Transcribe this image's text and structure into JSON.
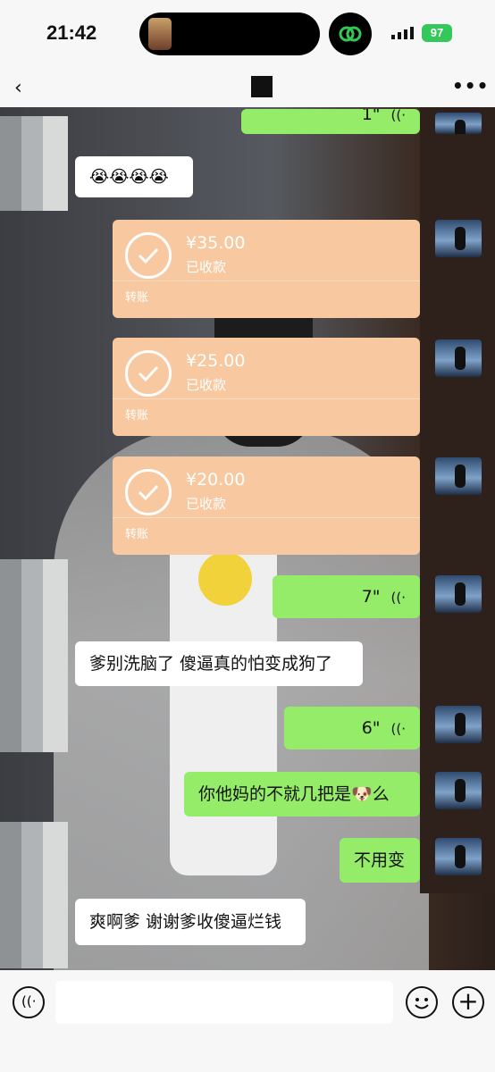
{
  "status_bar": {
    "time": "21:42",
    "battery": "97"
  },
  "header": {
    "back_label": "‹",
    "more_label": "•••"
  },
  "messages": [
    {
      "side": "right",
      "type": "voice",
      "duration": "1\"",
      "wave": "((·"
    },
    {
      "side": "left",
      "type": "text",
      "text": "😭😭😭😭"
    },
    {
      "side": "right",
      "type": "transfer",
      "amount": "¥35.00",
      "status": "已收款",
      "label": "转账"
    },
    {
      "side": "right",
      "type": "transfer",
      "amount": "¥25.00",
      "status": "已收款",
      "label": "转账"
    },
    {
      "side": "right",
      "type": "transfer",
      "amount": "¥20.00",
      "status": "已收款",
      "label": "转账"
    },
    {
      "side": "right",
      "type": "voice",
      "duration": "7\"",
      "wave": "((·"
    },
    {
      "side": "left",
      "type": "text",
      "text": "爹别洗脑了 傻逼真的怕变成狗了"
    },
    {
      "side": "right",
      "type": "voice",
      "duration": "6\"",
      "wave": "((·"
    },
    {
      "side": "right",
      "type": "text",
      "text": "你他妈的不就几把是🐶么"
    },
    {
      "side": "right",
      "type": "text",
      "text": "不用变"
    },
    {
      "side": "left",
      "type": "text",
      "text": "爽啊爹 谢谢爹收傻逼烂钱"
    }
  ],
  "input_bar": {
    "placeholder": "",
    "mic_icon": "voice-input-icon",
    "emoji_icon": "emoji-icon",
    "plus_icon": "plus-icon",
    "plus_label": "+"
  },
  "colors": {
    "green_bubble": "#95ec69",
    "transfer_bubble": "#f8c9a0",
    "white_bubble": "#ffffff"
  }
}
